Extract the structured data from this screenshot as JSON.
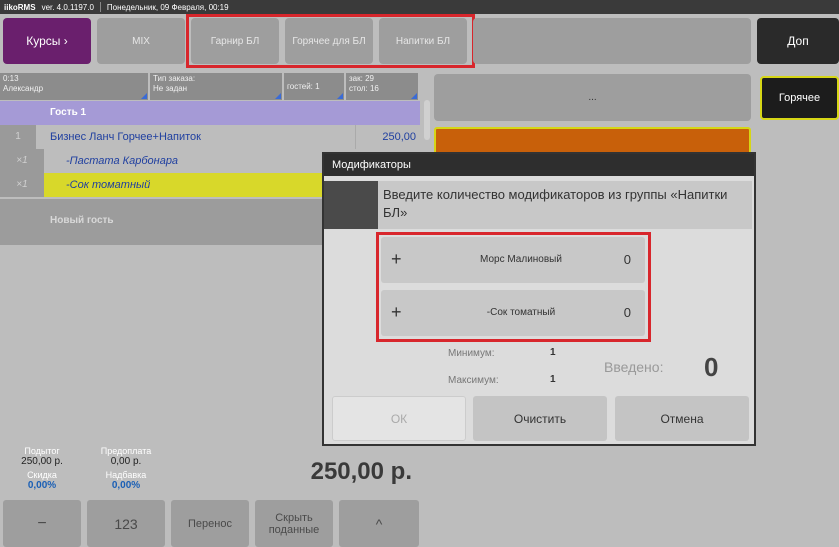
{
  "topbar": {
    "app": "iikoRMS",
    "version": "ver. 4.0.1197.0",
    "datetime": "Понедельник, 09 Февраля, 00:19"
  },
  "toolbar": {
    "courses": "Курсы",
    "mix": "MIX",
    "groups": [
      "Гарнир  БЛ",
      "Горячее для БЛ",
      "Напитки БЛ"
    ],
    "dop": "Доп",
    "hot": "Горячее",
    "dots": "..."
  },
  "order_header": {
    "time": "0:13",
    "waiter": "Александр",
    "order_type_label": "Тип заказа:",
    "order_type_value": "Не задан",
    "guests": "гостей: 1",
    "order_no": "зак: 29",
    "table": "стол: 16"
  },
  "guest": "Гость 1",
  "items": [
    {
      "qty": "1",
      "name": "Бизнес Ланч Горчее+Напиток",
      "price": "250,00"
    },
    {
      "qty": "×1",
      "name": "-Пастата Карбонара",
      "price": ""
    },
    {
      "qty": "×1",
      "name": "-Сок томатный",
      "price": ""
    }
  ],
  "new_guest": "Новый гость",
  "totals": {
    "subtotal_label": "Подытог",
    "subtotal": "250,00 р.",
    "prepay_label": "Предоплата",
    "prepay": "0,00 р.",
    "discount_label": "Скидка",
    "discount": "0,00%",
    "markup_label": "Надбавка",
    "markup": "0,00%",
    "total": "250,00 р."
  },
  "footer": {
    "minus": "−",
    "num": "123",
    "transfer": "Перенос",
    "hide": "Скрыть поданные",
    "up": "^"
  },
  "dialog": {
    "title": "Модификаторы",
    "prompt": "Введите количество модификаторов из группы «Напитки БЛ»",
    "modifiers": [
      {
        "name": "Морс Малиновый",
        "count": "0"
      },
      {
        "name": "-Сок томатный",
        "count": "0"
      }
    ],
    "min_label": "Минимум:",
    "min": "1",
    "max_label": "Максимум:",
    "max": "1",
    "entered_label": "Введено:",
    "entered": "0",
    "ok": "ОК",
    "clear": "Очистить",
    "cancel": "Отмена"
  },
  "colors": {
    "purple": "#6a1f6d",
    "yellow_row": "#d8d82a",
    "guest_row": "#a59ad6",
    "orange": "#c8600a",
    "red_highlight": "#d8262c"
  }
}
